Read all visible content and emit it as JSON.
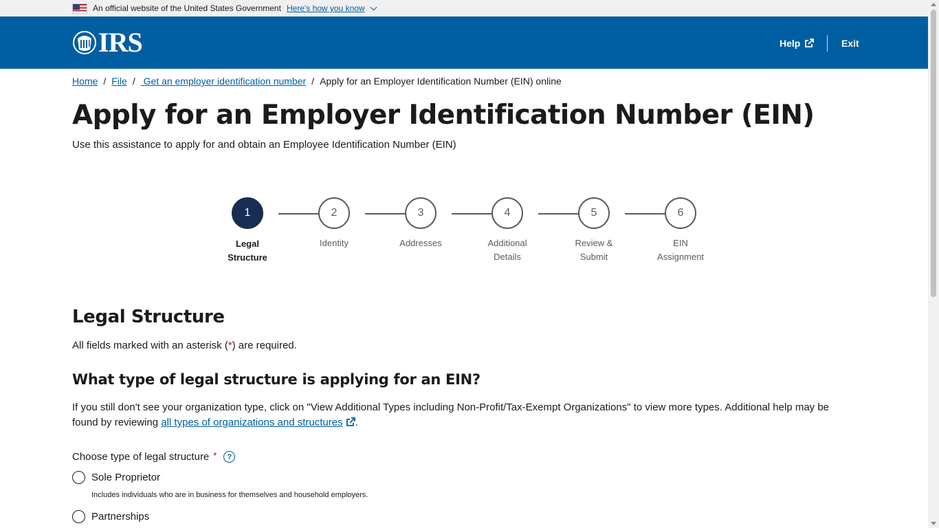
{
  "gov_banner": {
    "text": "An official website of the United States Government",
    "link": "Here's how you know"
  },
  "header": {
    "logo_text": "IRS",
    "help_label": "Help",
    "exit_label": "Exit",
    "brand_color": "#005ea2"
  },
  "breadcrumb": {
    "items": [
      "Home",
      "File",
      " Get an employer identification number"
    ],
    "current": "Apply for an Employer Identification Number (EIN) online",
    "separator": "/"
  },
  "page": {
    "title": "Apply for an Employer Identification Number (EIN)",
    "subtitle": "Use this assistance to apply for and obtain an Employee Identification Number (EIN)"
  },
  "stepper": {
    "steps": [
      {
        "number": "1",
        "line1": "Legal",
        "line2": "Structure",
        "active": true
      },
      {
        "number": "2",
        "line1": "Identity",
        "line2": "",
        "active": false
      },
      {
        "number": "3",
        "line1": "Addresses",
        "line2": "",
        "active": false
      },
      {
        "number": "4",
        "line1": "Additional",
        "line2": "Details",
        "active": false
      },
      {
        "number": "5",
        "line1": "Review &",
        "line2": "Submit",
        "active": false
      },
      {
        "number": "6",
        "line1": "EIN",
        "line2": "Assignment",
        "active": false
      }
    ]
  },
  "form": {
    "section_title": "Legal Structure",
    "required_prefix": "All fields marked with an asterisk (",
    "required_asterisk": "*",
    "required_suffix": ") are required.",
    "question": "What type of legal structure is applying for an EIN?",
    "help_text_1": "If you still don't see your organization type, click on \"View Additional Types including Non-Profit/Tax-Exempt Organizations\" to view more types. Additional help may be found by reviewing ",
    "help_link": "all types of organizations and structures",
    "help_text_2": ".",
    "choose_label": "Choose type of legal structure",
    "choose_asterisk": "*",
    "help_icon_glyph": "?",
    "options": [
      {
        "label": "Sole Proprietor",
        "description": "Includes individuals who are in business for themselves and household employers."
      },
      {
        "label": "Partnerships",
        "description": ""
      }
    ]
  }
}
